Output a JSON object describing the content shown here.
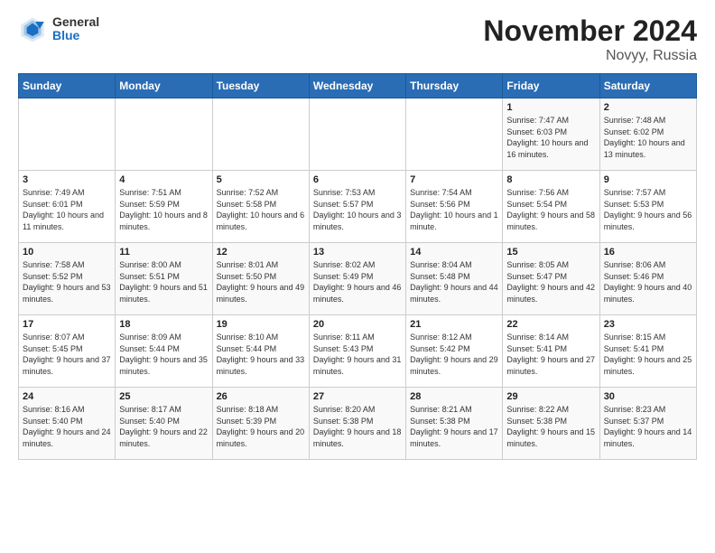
{
  "header": {
    "logo_general": "General",
    "logo_blue": "Blue",
    "title": "November 2024",
    "subtitle": "Novyy, Russia"
  },
  "days_of_week": [
    "Sunday",
    "Monday",
    "Tuesday",
    "Wednesday",
    "Thursday",
    "Friday",
    "Saturday"
  ],
  "weeks": [
    [
      {
        "day": "",
        "info": ""
      },
      {
        "day": "",
        "info": ""
      },
      {
        "day": "",
        "info": ""
      },
      {
        "day": "",
        "info": ""
      },
      {
        "day": "",
        "info": ""
      },
      {
        "day": "1",
        "info": "Sunrise: 7:47 AM\nSunset: 6:03 PM\nDaylight: 10 hours and 16 minutes."
      },
      {
        "day": "2",
        "info": "Sunrise: 7:48 AM\nSunset: 6:02 PM\nDaylight: 10 hours and 13 minutes."
      }
    ],
    [
      {
        "day": "3",
        "info": "Sunrise: 7:49 AM\nSunset: 6:01 PM\nDaylight: 10 hours and 11 minutes."
      },
      {
        "day": "4",
        "info": "Sunrise: 7:51 AM\nSunset: 5:59 PM\nDaylight: 10 hours and 8 minutes."
      },
      {
        "day": "5",
        "info": "Sunrise: 7:52 AM\nSunset: 5:58 PM\nDaylight: 10 hours and 6 minutes."
      },
      {
        "day": "6",
        "info": "Sunrise: 7:53 AM\nSunset: 5:57 PM\nDaylight: 10 hours and 3 minutes."
      },
      {
        "day": "7",
        "info": "Sunrise: 7:54 AM\nSunset: 5:56 PM\nDaylight: 10 hours and 1 minute."
      },
      {
        "day": "8",
        "info": "Sunrise: 7:56 AM\nSunset: 5:54 PM\nDaylight: 9 hours and 58 minutes."
      },
      {
        "day": "9",
        "info": "Sunrise: 7:57 AM\nSunset: 5:53 PM\nDaylight: 9 hours and 56 minutes."
      }
    ],
    [
      {
        "day": "10",
        "info": "Sunrise: 7:58 AM\nSunset: 5:52 PM\nDaylight: 9 hours and 53 minutes."
      },
      {
        "day": "11",
        "info": "Sunrise: 8:00 AM\nSunset: 5:51 PM\nDaylight: 9 hours and 51 minutes."
      },
      {
        "day": "12",
        "info": "Sunrise: 8:01 AM\nSunset: 5:50 PM\nDaylight: 9 hours and 49 minutes."
      },
      {
        "day": "13",
        "info": "Sunrise: 8:02 AM\nSunset: 5:49 PM\nDaylight: 9 hours and 46 minutes."
      },
      {
        "day": "14",
        "info": "Sunrise: 8:04 AM\nSunset: 5:48 PM\nDaylight: 9 hours and 44 minutes."
      },
      {
        "day": "15",
        "info": "Sunrise: 8:05 AM\nSunset: 5:47 PM\nDaylight: 9 hours and 42 minutes."
      },
      {
        "day": "16",
        "info": "Sunrise: 8:06 AM\nSunset: 5:46 PM\nDaylight: 9 hours and 40 minutes."
      }
    ],
    [
      {
        "day": "17",
        "info": "Sunrise: 8:07 AM\nSunset: 5:45 PM\nDaylight: 9 hours and 37 minutes."
      },
      {
        "day": "18",
        "info": "Sunrise: 8:09 AM\nSunset: 5:44 PM\nDaylight: 9 hours and 35 minutes."
      },
      {
        "day": "19",
        "info": "Sunrise: 8:10 AM\nSunset: 5:44 PM\nDaylight: 9 hours and 33 minutes."
      },
      {
        "day": "20",
        "info": "Sunrise: 8:11 AM\nSunset: 5:43 PM\nDaylight: 9 hours and 31 minutes."
      },
      {
        "day": "21",
        "info": "Sunrise: 8:12 AM\nSunset: 5:42 PM\nDaylight: 9 hours and 29 minutes."
      },
      {
        "day": "22",
        "info": "Sunrise: 8:14 AM\nSunset: 5:41 PM\nDaylight: 9 hours and 27 minutes."
      },
      {
        "day": "23",
        "info": "Sunrise: 8:15 AM\nSunset: 5:41 PM\nDaylight: 9 hours and 25 minutes."
      }
    ],
    [
      {
        "day": "24",
        "info": "Sunrise: 8:16 AM\nSunset: 5:40 PM\nDaylight: 9 hours and 24 minutes."
      },
      {
        "day": "25",
        "info": "Sunrise: 8:17 AM\nSunset: 5:40 PM\nDaylight: 9 hours and 22 minutes."
      },
      {
        "day": "26",
        "info": "Sunrise: 8:18 AM\nSunset: 5:39 PM\nDaylight: 9 hours and 20 minutes."
      },
      {
        "day": "27",
        "info": "Sunrise: 8:20 AM\nSunset: 5:38 PM\nDaylight: 9 hours and 18 minutes."
      },
      {
        "day": "28",
        "info": "Sunrise: 8:21 AM\nSunset: 5:38 PM\nDaylight: 9 hours and 17 minutes."
      },
      {
        "day": "29",
        "info": "Sunrise: 8:22 AM\nSunset: 5:38 PM\nDaylight: 9 hours and 15 minutes."
      },
      {
        "day": "30",
        "info": "Sunrise: 8:23 AM\nSunset: 5:37 PM\nDaylight: 9 hours and 14 minutes."
      }
    ]
  ]
}
